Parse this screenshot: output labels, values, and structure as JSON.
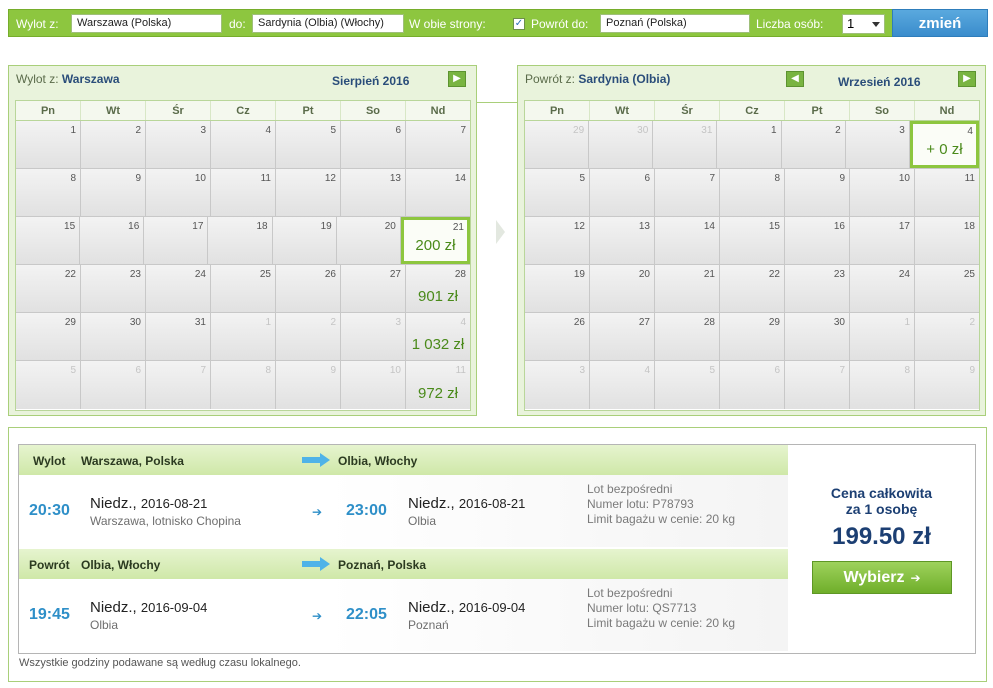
{
  "search": {
    "from_label": "Wylot z:",
    "from_value": "Warszawa (Polska)",
    "to_label": "do:",
    "to_value": "Sardynia (Olbia) (Włochy)",
    "both_ways_label": "W obie strony:",
    "both_ways_checked": "✓",
    "return_to_label": "Powrót do:",
    "return_to_value": "Poznań (Polska)",
    "persons_label": "Liczba osób:",
    "persons_value": "1",
    "change_button": "zmień"
  },
  "outbound_calendar": {
    "label": "Wylot z:",
    "city": "Warszawa",
    "month": "Sierpień 2016",
    "next_icon": "arrow-right-icon",
    "weekdays": [
      "Pn",
      "Wt",
      "Śr",
      "Cz",
      "Pt",
      "So",
      "Nd"
    ],
    "weeks": [
      [
        {
          "n": "1"
        },
        {
          "n": "2"
        },
        {
          "n": "3"
        },
        {
          "n": "4"
        },
        {
          "n": "5"
        },
        {
          "n": "6"
        },
        {
          "n": "7"
        }
      ],
      [
        {
          "n": "8"
        },
        {
          "n": "9"
        },
        {
          "n": "10"
        },
        {
          "n": "11"
        },
        {
          "n": "12"
        },
        {
          "n": "13"
        },
        {
          "n": "14"
        }
      ],
      [
        {
          "n": "15"
        },
        {
          "n": "16"
        },
        {
          "n": "17"
        },
        {
          "n": "18"
        },
        {
          "n": "19"
        },
        {
          "n": "20"
        },
        {
          "n": "21",
          "price": "200 zł",
          "selected": true
        }
      ],
      [
        {
          "n": "22"
        },
        {
          "n": "23"
        },
        {
          "n": "24"
        },
        {
          "n": "25"
        },
        {
          "n": "26"
        },
        {
          "n": "27"
        },
        {
          "n": "28",
          "price": "901 zł"
        }
      ],
      [
        {
          "n": "29"
        },
        {
          "n": "30"
        },
        {
          "n": "31"
        },
        {
          "n": "1",
          "other": true
        },
        {
          "n": "2",
          "other": true
        },
        {
          "n": "3",
          "other": true
        },
        {
          "n": "4",
          "other": true,
          "price": "1 032 zł"
        }
      ],
      [
        {
          "n": "5",
          "other": true
        },
        {
          "n": "6",
          "other": true
        },
        {
          "n": "7",
          "other": true
        },
        {
          "n": "8",
          "other": true
        },
        {
          "n": "9",
          "other": true
        },
        {
          "n": "10",
          "other": true
        },
        {
          "n": "11",
          "other": true,
          "price": "972 zł"
        }
      ]
    ]
  },
  "return_calendar": {
    "label": "Powrót z:",
    "city": "Sardynia (Olbia)",
    "month": "Wrzesień 2016",
    "prev_icon": "arrow-left-icon",
    "next_icon": "arrow-right-icon",
    "weekdays": [
      "Pn",
      "Wt",
      "Śr",
      "Cz",
      "Pt",
      "So",
      "Nd"
    ],
    "weeks": [
      [
        {
          "n": "29",
          "other": true
        },
        {
          "n": "30",
          "other": true
        },
        {
          "n": "31",
          "other": true
        },
        {
          "n": "1"
        },
        {
          "n": "2"
        },
        {
          "n": "3"
        },
        {
          "n": "4",
          "price": "+ 0 zł",
          "selected": true
        }
      ],
      [
        {
          "n": "5"
        },
        {
          "n": "6"
        },
        {
          "n": "7"
        },
        {
          "n": "8"
        },
        {
          "n": "9"
        },
        {
          "n": "10"
        },
        {
          "n": "11"
        }
      ],
      [
        {
          "n": "12"
        },
        {
          "n": "13"
        },
        {
          "n": "14"
        },
        {
          "n": "15"
        },
        {
          "n": "16"
        },
        {
          "n": "17"
        },
        {
          "n": "18"
        }
      ],
      [
        {
          "n": "19"
        },
        {
          "n": "20"
        },
        {
          "n": "21"
        },
        {
          "n": "22"
        },
        {
          "n": "23"
        },
        {
          "n": "24"
        },
        {
          "n": "25"
        }
      ],
      [
        {
          "n": "26"
        },
        {
          "n": "27"
        },
        {
          "n": "28"
        },
        {
          "n": "29"
        },
        {
          "n": "30"
        },
        {
          "n": "1",
          "other": true
        },
        {
          "n": "2",
          "other": true
        }
      ],
      [
        {
          "n": "3",
          "other": true
        },
        {
          "n": "4",
          "other": true
        },
        {
          "n": "5",
          "other": true
        },
        {
          "n": "6",
          "other": true
        },
        {
          "n": "7",
          "other": true
        },
        {
          "n": "8",
          "other": true
        },
        {
          "n": "9",
          "other": true
        }
      ]
    ]
  },
  "outbound": {
    "heading": "Wylot",
    "from": "Warszawa, Polska",
    "to": "Olbia, Włochy",
    "dep_time": "20:30",
    "dep_day": "Niedz.",
    "dep_date": "2016-08-21",
    "dep_place": "Warszawa, lotnisko Chopina",
    "arr_time": "23:00",
    "arr_day": "Niedz.",
    "arr_date": "2016-08-21",
    "arr_place": "Olbia",
    "info": [
      "Lot bezpośredni",
      "Numer lotu: P78793",
      "Limit bagażu w cenie: 20 kg"
    ]
  },
  "return": {
    "heading": "Powrót",
    "from": "Olbia, Włochy",
    "to": "Poznań, Polska",
    "dep_time": "19:45",
    "dep_day": "Niedz.",
    "dep_date": "2016-09-04",
    "dep_place": "Olbia",
    "arr_time": "22:05",
    "arr_day": "Niedz.",
    "arr_date": "2016-09-04",
    "arr_place": "Poznań",
    "info": [
      "Lot bezpośredni",
      "Numer lotu: QS7713",
      "Limit bagażu w cenie: 20 kg"
    ]
  },
  "price": {
    "caption_line1": "Cena całkowita",
    "caption_line2": "za 1 osobę",
    "total": "199.50 zł",
    "choose_button": "Wybierz"
  },
  "footnote": "Wszystkie godziny podawane są według czasu lokalnego.",
  "colors": {
    "accent_green": "#8dc63f",
    "button_blue": "#3a8ccc",
    "price_green": "#4a8a1a",
    "time_blue": "#2e8fc8",
    "heading_navy": "#1c3f73"
  }
}
